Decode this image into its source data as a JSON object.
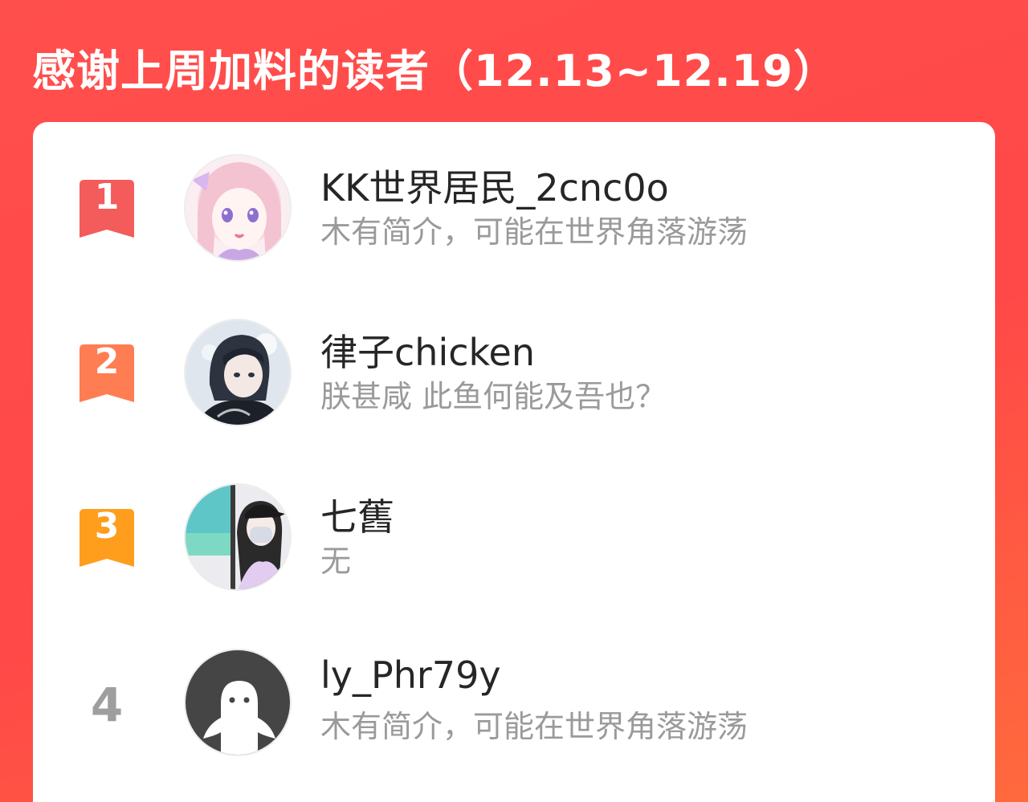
{
  "header": {
    "title": "感谢上周加料的读者（12.13~12.19）"
  },
  "colors": {
    "background": "#ff4848",
    "rank1": "#f45b5b",
    "rank2": "#ff7d52",
    "rank3": "#ff9d1c",
    "rank_plain": "#9e9e9e"
  },
  "readers": [
    {
      "rank": "1",
      "name": "KK世界居民_2cnc0o",
      "bio": "木有简介，可能在世界角落游荡",
      "avatar": "anime-girl-pink-hair-avatar"
    },
    {
      "rank": "2",
      "name": "律子chicken",
      "bio": "朕甚咸 此鱼何能及吾也？",
      "avatar": "anime-boy-dark-hair-avatar"
    },
    {
      "rank": "3",
      "name": "七舊",
      "bio": "无",
      "avatar": "girl-black-cap-avatar"
    },
    {
      "rank": "4",
      "name": "ly_Phr79y",
      "bio": "木有简介，可能在世界角落游荡",
      "avatar": "default-ghost-avatar"
    }
  ]
}
